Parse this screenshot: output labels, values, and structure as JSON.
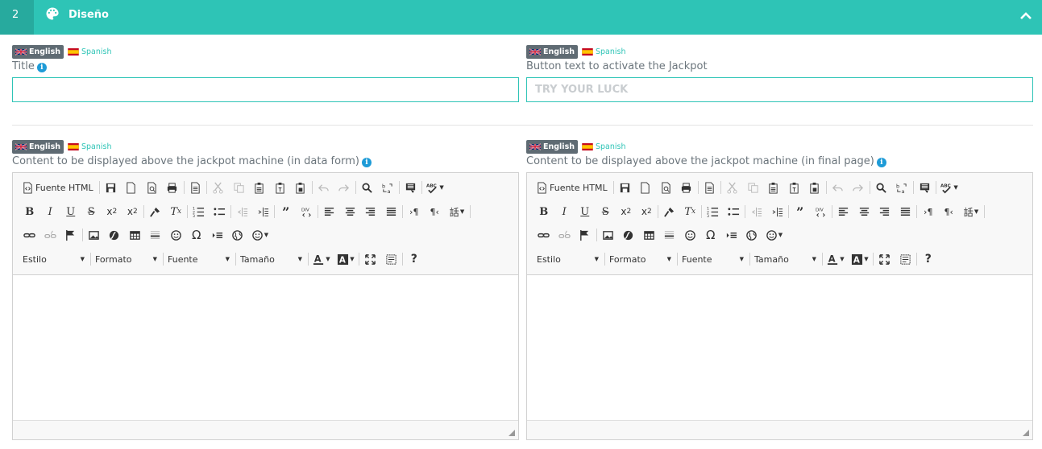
{
  "section": {
    "number": "2",
    "title": "Diseño",
    "accent": "#2ec4b6"
  },
  "languages": {
    "active": "English",
    "inactive": "Spanish"
  },
  "fields": {
    "title": {
      "label": "Title",
      "value": "",
      "placeholder": ""
    },
    "button_text": {
      "label": "Button text to activate the Jackpot",
      "value": "",
      "placeholder": "TRY YOUR LUCK"
    },
    "content_data_form": {
      "label": "Content to be displayed above the jackpot machine (in data form)"
    },
    "content_final_page": {
      "label": "Content to be displayed above the jackpot machine (in final page)"
    }
  },
  "editor": {
    "source_label": "Fuente HTML",
    "combos": {
      "style": "Estilo",
      "format": "Formato",
      "font": "Fuente",
      "size": "Tamaño"
    },
    "help": "?"
  },
  "icons": [
    "palette-icon",
    "chevron-up-icon",
    "info-icon",
    "uk-flag-icon",
    "spain-flag-icon"
  ]
}
